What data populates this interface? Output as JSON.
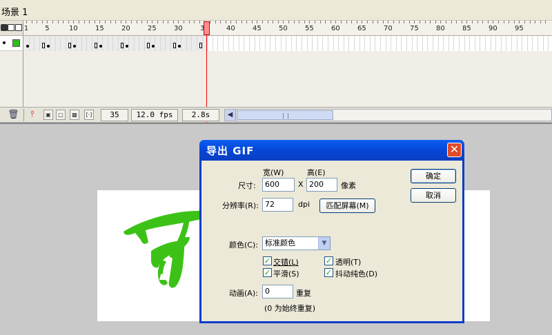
{
  "scene": {
    "title": "场景 1"
  },
  "timeline": {
    "ruler_labels": [
      "1",
      "5",
      "10",
      "15",
      "20",
      "25",
      "30",
      "35",
      "40",
      "45",
      "50",
      "55",
      "60",
      "65",
      "70",
      "75",
      "80",
      "85",
      "90",
      "95"
    ],
    "current_frame_marker": "35"
  },
  "status": {
    "frame": "35",
    "fps": "12.0 fps",
    "time": "2.8s",
    "trash_icon": "trash-icon"
  },
  "colors": {
    "layer_color": "#2ebd1e",
    "artwork": "#3cc217",
    "dialog_title": "#0546d8"
  },
  "dialog": {
    "title": "导出 GIF",
    "close_label": "✕",
    "width_header": "宽(W)",
    "height_header": "高(E)",
    "size_label": "尺寸:",
    "width_value": "600",
    "x_label": "X",
    "height_value": "200",
    "pixels_label": "像素",
    "resolution_label": "分辨率(R):",
    "resolution_value": "72",
    "dpi_label": "dpi",
    "match_screen_button": "匹配屏幕(M)",
    "ok_button": "确定",
    "cancel_button": "取消",
    "colors_label": "颜色(C):",
    "colors_value": "标准颜色",
    "interlace_label": "交错(L)",
    "transparent_label": "透明(T)",
    "smooth_label": "平滑(S)",
    "dither_label": "抖动纯色(D)",
    "interlace_checked": true,
    "transparent_checked": true,
    "smooth_checked": true,
    "dither_checked": true,
    "animation_label": "动画(A):",
    "animation_value": "0",
    "repeat_label": "重复",
    "repeat_hint": "(0 为始终重复)"
  }
}
